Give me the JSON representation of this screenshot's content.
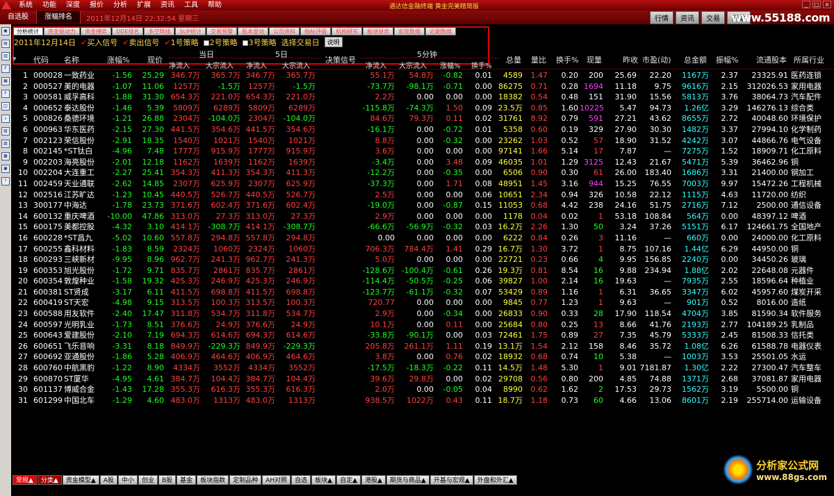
{
  "menu": [
    "系统",
    "功能",
    "深度",
    "报价",
    "分析",
    "扩展",
    "资讯",
    "工具",
    "帮助"
  ],
  "title_center": "通达信金融终端  黄金完美精简版",
  "bar2": {
    "tabs": [
      "自选股",
      "涨幅排名"
    ],
    "datetime": "2011年12月14日  22:32:54 星期三",
    "buttons": [
      "行情",
      "资讯",
      "交易",
      "网站"
    ],
    "site": "www.55188.com"
  },
  "subtabs": [
    "分析统计",
    "资金驱动力",
    "资金搏弈",
    "DDE排名",
    "多空阵线",
    "SUP统计",
    "交易预警",
    "股本变动",
    "公司资料",
    "指标评级",
    "机构研究",
    "板块财务",
    "宏观数据",
    "近期数据"
  ],
  "options": {
    "date": "2011年12月14日",
    "checks": [
      {
        "label": "买入信号",
        "checked": true
      },
      {
        "label": "卖出信号",
        "checked": true
      },
      {
        "label": "1号策略",
        "checked": true
      },
      {
        "label": "2号策略",
        "checked": false
      },
      {
        "label": "3号策略",
        "checked": false
      }
    ],
    "select_label": "选择交易日",
    "help": "说明"
  },
  "header": {
    "top": {
      "day": "当日",
      "five": "5日",
      "min5": "5分钟"
    },
    "cols": [
      "代码",
      "名称",
      "涨幅%",
      "现价",
      "决策信号",
      "总量",
      "量比",
      "换手%",
      "现量",
      "昨收",
      "市盈(动)",
      "总金额",
      "振幅%",
      "流通股本",
      "所属行业"
    ],
    "sub": [
      "净流入",
      "大宗流入",
      "净流入",
      "大宗流入",
      "净流入",
      "大宗流入",
      "涨幅%",
      "换手%"
    ]
  },
  "rows": [
    {
      "n": "1",
      "code": "000028",
      "name": "一致药业",
      "chg": "-1.56",
      "price": "25.29",
      "a": "346.7万",
      "b": "365.7万",
      "c": "346.7万",
      "d": "365.7万",
      "e": "55.1万",
      "f": "54.8万",
      "g": "-0.82",
      "h": "0.01",
      "vol": "4589",
      "lb": "1.47",
      "hs": "0.20",
      "xl": "200",
      "zs": "25.69",
      "pe": "22.20",
      "amt": "1167万",
      "zf": "2.37",
      "lt": "23325.91",
      "ind": "医药连锁"
    },
    {
      "n": "2",
      "code": "000527",
      "name": "美的电器",
      "chg": "-1.07",
      "price": "11.06",
      "a": "1257万",
      "b": "-1.5万",
      "c": "1257万",
      "d": "-1.5万",
      "e": "-73.7万",
      "f": "-98.1万",
      "g": "-0.71",
      "h": "0.00",
      "vol": "86275",
      "lb": "0.71",
      "hs": "0.28",
      "xl": "1694",
      "zs": "11.18",
      "pe": "9.75",
      "amt": "9616万",
      "zf": "2.15",
      "lt": "312026.53",
      "ind": "家用电器"
    },
    {
      "n": "3",
      "code": "000581",
      "name": "威孚高科",
      "chg": "-1.88",
      "price": "31.30",
      "a": "654.3万",
      "b": "221.0万",
      "c": "654.3万",
      "d": "221.0万",
      "e": "2.2万",
      "f": "0.00",
      "g": "0.00",
      "h": "0.00",
      "vol": "18382",
      "lb": "0.54",
      "hs": "0.48",
      "xl": "151",
      "zs": "31.90",
      "pe": "15.56",
      "amt": "5813万",
      "zf": "3.76",
      "lt": "38064.73",
      "ind": "汽车配件"
    },
    {
      "n": "4",
      "code": "000652",
      "name": "泰达股份",
      "chg": "-1.46",
      "price": "5.39",
      "a": "5809万",
      "b": "6289万",
      "c": "5809万",
      "d": "6289万",
      "e": "-115.8万",
      "f": "-74.3万",
      "g": "1.50",
      "h": "0.09",
      "vol": "23.5万",
      "lb": "0.85",
      "hs": "1.60",
      "xl": "10225",
      "zs": "5.47",
      "pe": "94.73",
      "amt": "1.26亿",
      "zf": "3.29",
      "lt": "146276.13",
      "ind": "综合类"
    },
    {
      "n": "5",
      "code": "000826",
      "name": "桑德环境",
      "chg": "-1.21",
      "price": "26.88",
      "a": "2304万",
      "b": "-104.0万",
      "c": "2304万",
      "d": "-104.0万",
      "e": "84.6万",
      "f": "79.3万",
      "g": "0.11",
      "h": "0.02",
      "vol": "31761",
      "lb": "8.92",
      "hs": "0.79",
      "xl": "591",
      "zs": "27.21",
      "pe": "43.62",
      "amt": "8655万",
      "zf": "2.72",
      "lt": "40048.60",
      "ind": "环境保护"
    },
    {
      "n": "6",
      "code": "000963",
      "name": "华东医药",
      "chg": "-2.15",
      "price": "27.30",
      "a": "441.5万",
      "b": "354.6万",
      "c": "441.5万",
      "d": "354.6万",
      "e": "-16.1万",
      "f": "0.00",
      "g": "-0.72",
      "h": "0.01",
      "vol": "5358",
      "lb": "0.60",
      "hs": "0.19",
      "xl": "329",
      "zs": "27.90",
      "pe": "30.30",
      "amt": "1482万",
      "zf": "3.37",
      "lt": "27994.10",
      "ind": "化学制药"
    },
    {
      "n": "7",
      "code": "002123",
      "name": "荣信股份",
      "chg": "-2.91",
      "price": "18.35",
      "a": "1540万",
      "b": "1021万",
      "c": "1540万",
      "d": "1021万",
      "e": "8.8万",
      "f": "0.00",
      "g": "-0.32",
      "h": "0.00",
      "vol": "23262",
      "lb": "1.03",
      "hs": "0.52",
      "xl": "57",
      "zs": "18.90",
      "pe": "31.52",
      "amt": "4242万",
      "zf": "3.07",
      "lt": "44866.76",
      "ind": "电气设备"
    },
    {
      "n": "8",
      "code": "002145",
      "name": "*ST钛白",
      "chg": "-4.96",
      "price": "7.48",
      "a": "1777万",
      "b": "915.9万",
      "c": "1777万",
      "d": "915.9万",
      "e": "3.6万",
      "f": "0.00",
      "g": "0.00",
      "h": "0.00",
      "vol": "97141",
      "lb": "1.66",
      "hs": "5.14",
      "xl": "17",
      "zs": "7.87",
      "pe": "—",
      "amt": "7275万",
      "zf": "1.52",
      "lt": "18909.71",
      "ind": "化工原料"
    },
    {
      "n": "9",
      "code": "002203",
      "name": "海亮股份",
      "chg": "-2.01",
      "price": "12.18",
      "a": "1162万",
      "b": "1639万",
      "c": "1162万",
      "d": "1639万",
      "e": "-3.4万",
      "f": "0.00",
      "g": "3.48",
      "h": "0.09",
      "vol": "46035",
      "lb": "1.01",
      "hs": "1.29",
      "xl": "3125",
      "zs": "12.43",
      "pe": "21.67",
      "amt": "5471万",
      "zf": "5.39",
      "lt": "36462.96",
      "ind": "铜"
    },
    {
      "n": "10",
      "code": "002204",
      "name": "大连重工",
      "chg": "-2.27",
      "price": "25.41",
      "a": "354.3万",
      "b": "411.3万",
      "c": "354.3万",
      "d": "411.3万",
      "e": "-12.2万",
      "f": "0.00",
      "g": "-0.35",
      "h": "0.00",
      "vol": "6506",
      "lb": "0.90",
      "hs": "0.30",
      "xl": "61",
      "zs": "26.00",
      "pe": "183.40",
      "amt": "1686万",
      "zf": "3.31",
      "lt": "21400.00",
      "ind": "钢加工"
    },
    {
      "n": "11",
      "code": "002459",
      "name": "天业通联",
      "chg": "-2.62",
      "price": "14.85",
      "a": "2307万",
      "b": "625.9万",
      "c": "2307万",
      "d": "625.9万",
      "e": "-37.3万",
      "f": "0.00",
      "g": "1.71",
      "h": "0.08",
      "vol": "48951",
      "lb": "1.45",
      "hs": "3.16",
      "xl": "944",
      "zs": "15.25",
      "pe": "76.55",
      "amt": "7003万",
      "zf": "9.97",
      "lt": "15472.26",
      "ind": "工程机械"
    },
    {
      "n": "12",
      "code": "002516",
      "name": "江苏旷达",
      "chg": "-1.23",
      "price": "10.45",
      "a": "440.5万",
      "b": "526.7万",
      "c": "440.5万",
      "d": "526.7万",
      "e": "2.5万",
      "f": "0.00",
      "g": "0.00",
      "h": "0.06",
      "vol": "10651",
      "lb": "2.34",
      "hs": "0.94",
      "xl": "326",
      "zs": "10.58",
      "pe": "22.12",
      "amt": "1115万",
      "zf": "4.63",
      "lt": "11720.00",
      "ind": "纺织"
    },
    {
      "n": "13",
      "code": "300177",
      "name": "中海达",
      "chg": "-1.78",
      "price": "23.73",
      "a": "371.6万",
      "b": "602.4万",
      "c": "371.6万",
      "d": "602.4万",
      "e": "-19.0万",
      "f": "0.00",
      "g": "-0.87",
      "h": "0.15",
      "vol": "11053",
      "lb": "0.68",
      "hs": "4.42",
      "xl": "238",
      "zs": "24.16",
      "pe": "51.75",
      "amt": "2716万",
      "zf": "7.12",
      "lt": "2500.00",
      "ind": "通信设备"
    },
    {
      "n": "14",
      "code": "600132",
      "name": "重庆啤酒",
      "chg": "-10.00",
      "price": "47.86",
      "a": "313.0万",
      "b": "27.3万",
      "c": "313.0万",
      "d": "27.3万",
      "e": "2.9万",
      "f": "0.00",
      "g": "0.00",
      "h": "0.00",
      "vol": "1178",
      "lb": "0.04",
      "hs": "0.02",
      "xl": "1",
      "zs": "53.18",
      "pe": "108.84",
      "amt": "564万",
      "zf": "0.00",
      "lt": "48397.12",
      "ind": "啤酒"
    },
    {
      "n": "15",
      "code": "600175",
      "name": "美都控股",
      "chg": "-4.32",
      "price": "3.10",
      "a": "414.1万",
      "b": "-308.7万",
      "c": "414.1万",
      "d": "-308.7万",
      "e": "-66.6万",
      "f": "-56.9万",
      "g": "-0.32",
      "h": "0.03",
      "vol": "16.2万",
      "lb": "2.26",
      "hs": "1.30",
      "xl": "50",
      "zs": "3.24",
      "pe": "37.26",
      "amt": "5151万",
      "zf": "6.17",
      "lt": "124661.75",
      "ind": "全国地产"
    },
    {
      "n": "16",
      "code": "600228",
      "name": "*ST昌九",
      "chg": "-5.02",
      "price": "10.60",
      "a": "557.8万",
      "b": "294.8万",
      "c": "557.8万",
      "d": "294.8万",
      "e": "0.00",
      "f": "0.00",
      "g": "0.00",
      "h": "0.00",
      "vol": "6222",
      "lb": "0.84",
      "hs": "0.26",
      "xl": "3",
      "zs": "11.16",
      "pe": "—",
      "amt": "660万",
      "zf": "0.00",
      "lt": "24000.00",
      "ind": "化工原料"
    },
    {
      "n": "17",
      "code": "600255",
      "name": "鑫科材料",
      "chg": "-1.83",
      "price": "8.59",
      "a": "2324万",
      "b": "1060万",
      "c": "2324万",
      "d": "1060万",
      "e": "706.3万",
      "f": "784.4万",
      "g": "1.41",
      "h": "0.29",
      "vol": "16.7万",
      "lb": "1.30",
      "hs": "3.72",
      "xl": "1",
      "zs": "8.75",
      "pe": "107.16",
      "amt": "1.44亿",
      "zf": "6.29",
      "lt": "44950.00",
      "ind": "铜"
    },
    {
      "n": "18",
      "code": "600293",
      "name": "三峡新材",
      "chg": "-9.95",
      "price": "8.96",
      "a": "962.7万",
      "b": "241.3万",
      "c": "962.7万",
      "d": "241.3万",
      "e": "5.0万",
      "f": "0.00",
      "g": "0.00",
      "h": "0.00",
      "vol": "22721",
      "lb": "0.23",
      "hs": "0.66",
      "xl": "4",
      "zs": "9.95",
      "pe": "156.85",
      "amt": "2240万",
      "zf": "0.00",
      "lt": "34450.26",
      "ind": "玻璃"
    },
    {
      "n": "19",
      "code": "600353",
      "name": "旭光股份",
      "chg": "-1.72",
      "price": "9.71",
      "a": "835.7万",
      "b": "2861万",
      "c": "835.7万",
      "d": "2861万",
      "e": "-128.6万",
      "f": "-100.4万",
      "g": "-0.61",
      "h": "0.26",
      "vol": "19.3万",
      "lb": "0.81",
      "hs": "8.54",
      "xl": "16",
      "zs": "9.88",
      "pe": "234.94",
      "amt": "1.88亿",
      "zf": "2.02",
      "lt": "22648.08",
      "ind": "元器件"
    },
    {
      "n": "20",
      "code": "600354",
      "name": "敦煌种业",
      "chg": "-1.58",
      "price": "19.32",
      "a": "425.3万",
      "b": "246.9万",
      "c": "425.3万",
      "d": "246.9万",
      "e": "-114.4万",
      "f": "-50.5万",
      "g": "-0.25",
      "h": "0.06",
      "vol": "39827",
      "lb": "1.00",
      "hs": "2.14",
      "xl": "16",
      "zs": "19.63",
      "pe": "—",
      "amt": "7935万",
      "zf": "2.55",
      "lt": "18596.64",
      "ind": "种植业"
    },
    {
      "n": "21",
      "code": "600381",
      "name": "ST贤成",
      "chg": "-3.17",
      "price": "6.11",
      "a": "411.5万",
      "b": "698.8万",
      "c": "411.5万",
      "d": "698.8万",
      "e": "-123.7万",
      "f": "-61.1万",
      "g": "-0.32",
      "h": "0.07",
      "vol": "53429",
      "lb": "0.89",
      "hs": "1.16",
      "xl": "1",
      "zs": "6.31",
      "pe": "36.65",
      "amt": "3347万",
      "zf": "6.02",
      "lt": "45957.60",
      "ind": "煤炭开采"
    },
    {
      "n": "22",
      "code": "600419",
      "name": "ST天宏",
      "chg": "-4.98",
      "price": "9.15",
      "a": "313.5万",
      "b": "100.3万",
      "c": "313.5万",
      "d": "100.3万",
      "e": "720.77",
      "f": "0.00",
      "g": "0.00",
      "h": "0.00",
      "vol": "9845",
      "lb": "0.77",
      "hs": "1.23",
      "xl": "1",
      "zs": "9.63",
      "pe": "—",
      "amt": "901万",
      "zf": "0.52",
      "lt": "8016.00",
      "ind": "造纸"
    },
    {
      "n": "23",
      "code": "600588",
      "name": "用友软件",
      "chg": "-2.40",
      "price": "17.47",
      "a": "311.8万",
      "b": "534.7万",
      "c": "311.8万",
      "d": "534.7万",
      "e": "2.9万",
      "f": "0.00",
      "g": "-0.34",
      "h": "0.00",
      "vol": "26833",
      "lb": "0.90",
      "hs": "0.33",
      "xl": "28",
      "zs": "17.90",
      "pe": "118.54",
      "amt": "4704万",
      "zf": "3.85",
      "lt": "81590.34",
      "ind": "软件服务"
    },
    {
      "n": "24",
      "code": "600597",
      "name": "光明乳业",
      "chg": "-1.73",
      "price": "8.51",
      "a": "376.6万",
      "b": "24.9万",
      "c": "376.6万",
      "d": "24.9万",
      "e": "10.1万",
      "f": "0.00",
      "g": "0.11",
      "h": "0.00",
      "vol": "25684",
      "lb": "0.80",
      "hs": "0.25",
      "xl": "13",
      "zs": "8.66",
      "pe": "41.76",
      "amt": "2193万",
      "zf": "2.77",
      "lt": "104189.25",
      "ind": "乳制品"
    },
    {
      "n": "25",
      "code": "600643",
      "name": "爱建股份",
      "chg": "-2.10",
      "price": "7.19",
      "a": "694.3万",
      "b": "614.6万",
      "c": "694.3万",
      "d": "614.6万",
      "e": "-33.8万",
      "f": "-90.1万",
      "g": "0.00",
      "h": "0.03",
      "vol": "72461",
      "lb": "1.75",
      "hs": "0.89",
      "xl": "27",
      "zs": "7.35",
      "pe": "45.79",
      "amt": "5333万",
      "zf": "2.45",
      "lt": "81508.33",
      "ind": "信托类"
    },
    {
      "n": "26",
      "code": "600651",
      "name": "飞乐音响",
      "chg": "-3.31",
      "price": "8.18",
      "a": "849.9万",
      "b": "-229.3万",
      "c": "849.9万",
      "d": "-229.3万",
      "e": "205.8万",
      "f": "261.1万",
      "g": "1.11",
      "h": "0.19",
      "vol": "13.1万",
      "lb": "1.54",
      "hs": "2.12",
      "xl": "158",
      "zs": "8.46",
      "pe": "35.72",
      "amt": "1.08亿",
      "zf": "6.26",
      "lt": "61588.78",
      "ind": "电器仪表"
    },
    {
      "n": "27",
      "code": "600692",
      "name": "亚通股份",
      "chg": "-1.86",
      "price": "5.28",
      "a": "406.9万",
      "b": "464.6万",
      "c": "406.9万",
      "d": "464.6万",
      "e": "3.8万",
      "f": "0.00",
      "g": "0.76",
      "h": "0.02",
      "vol": "18932",
      "lb": "0.68",
      "hs": "0.74",
      "xl": "10",
      "zs": "5.38",
      "pe": "—",
      "amt": "1003万",
      "zf": "3.53",
      "lt": "25501.05",
      "ind": "水运"
    },
    {
      "n": "28",
      "code": "600760",
      "name": "中航黑豹",
      "chg": "-1.22",
      "price": "8.90",
      "a": "4334万",
      "b": "3552万",
      "c": "4334万",
      "d": "3552万",
      "e": "-17.5万",
      "f": "-18.3万",
      "g": "-0.22",
      "h": "0.11",
      "vol": "14.5万",
      "lb": "1.48",
      "hs": "5.30",
      "xl": "1",
      "zs": "9.01",
      "pe": "7181.87",
      "amt": "1.30亿",
      "zf": "2.22",
      "lt": "27300.47",
      "ind": "汽车整车"
    },
    {
      "n": "29",
      "code": "600870",
      "name": "ST厦华",
      "chg": "-4.95",
      "price": "4.61",
      "a": "384.7万",
      "b": "104.4万",
      "c": "384.7万",
      "d": "104.4万",
      "e": "39.6万",
      "f": "29.8万",
      "g": "0.00",
      "h": "0.02",
      "vol": "29708",
      "lb": "0.56",
      "hs": "0.80",
      "xl": "200",
      "zs": "4.85",
      "pe": "74.88",
      "amt": "1371万",
      "zf": "2.68",
      "lt": "37081.87",
      "ind": "家用电器"
    },
    {
      "n": "30",
      "code": "601137",
      "name": "博威合金",
      "chg": "-1.43",
      "price": "17.28",
      "a": "355.3万",
      "b": "616.3万",
      "c": "355.3万",
      "d": "616.3万",
      "e": "2.0万",
      "f": "0.00",
      "g": "-0.05",
      "h": "0.04",
      "vol": "8990",
      "lb": "0.62",
      "hs": "1.62",
      "xl": "2",
      "zs": "17.53",
      "pe": "29.73",
      "amt": "1562万",
      "zf": "3.19",
      "lt": "5500.00",
      "ind": "铜"
    },
    {
      "n": "31",
      "code": "601299",
      "name": "中国北车",
      "chg": "-1.29",
      "price": "4.60",
      "a": "483.0万",
      "b": "1313万",
      "c": "483.0万",
      "d": "1313万",
      "e": "938.5万",
      "f": "1022万",
      "g": "0.43",
      "h": "0.11",
      "vol": "18.7万",
      "lb": "1.18",
      "hs": "0.73",
      "xl": "60",
      "zs": "4.66",
      "pe": "13.06",
      "amt": "8601万",
      "zf": "2.19",
      "lt": "255714.00",
      "ind": "运输设备"
    }
  ],
  "bottom_tabs": [
    "常规▲",
    "分类▲",
    "资金模型▲",
    "A股",
    "中小",
    "创业",
    "B股",
    "基金",
    "板块指数",
    "定制品种",
    "AH对照",
    "自选",
    "板块▲",
    "自定▲",
    "港股▲",
    "期货与商品▲",
    "开基与宏观▲",
    "外盘和外汇▲"
  ],
  "watermark": {
    "title": "分析家公式网",
    "url": "www.88gs.com"
  }
}
